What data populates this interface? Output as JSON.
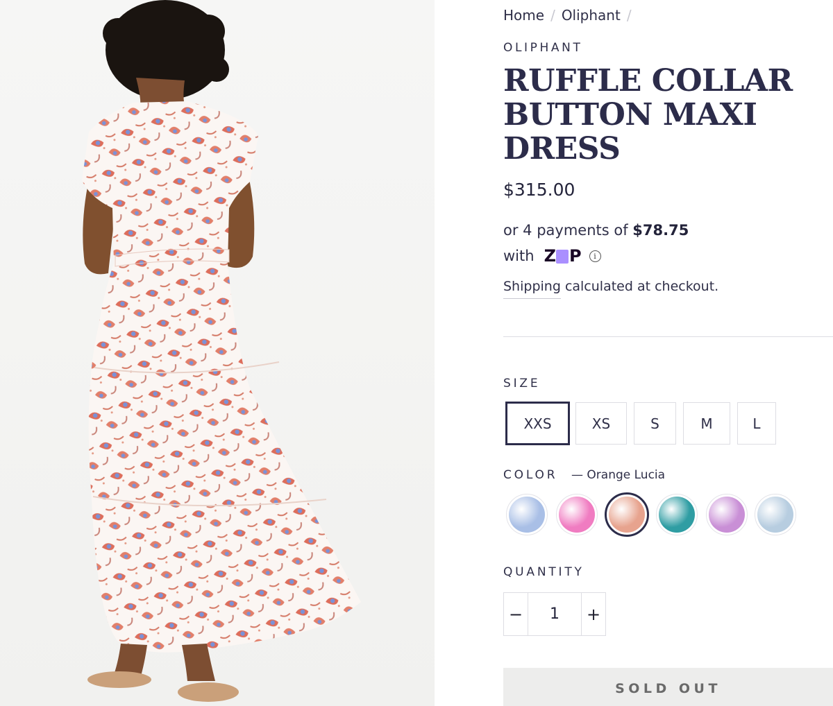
{
  "breadcrumb": {
    "items": [
      "Home",
      "Oliphant"
    ],
    "separator": "/"
  },
  "product": {
    "vendor": "OLIPHANT",
    "title": "RUFFLE COLLAR BUTTON MAXI DRESS",
    "price": "$315.00",
    "installments": {
      "prefix": "or 4 payments of",
      "amount": "$78.75",
      "with_label": "with",
      "provider": "zip",
      "info_glyph": "i"
    },
    "shipping": {
      "link_text": "Shipping",
      "rest_text": "calculated at checkout."
    }
  },
  "size": {
    "label": "SIZE",
    "options": [
      "XXS",
      "XS",
      "S",
      "M",
      "L"
    ],
    "selected": "XXS"
  },
  "color": {
    "label": "COLOR",
    "selected_display": "— Orange Lucia",
    "selected_index": 2,
    "swatches": [
      {
        "color": "#a9bfe6"
      },
      {
        "color": "#f07cc1"
      },
      {
        "color": "#e7a38e"
      },
      {
        "color": "#2f9da3"
      },
      {
        "color": "#c98fd6"
      },
      {
        "color": "#b7cde0"
      }
    ]
  },
  "quantity": {
    "label": "QUANTITY",
    "value": "1",
    "decrement_glyph": "−",
    "increment_glyph": "+"
  },
  "buy": {
    "sold_out_label": "SOLD OUT"
  },
  "colors": {
    "primary_text": "#2c2c4a",
    "zip_purple": "#aa8fff",
    "sold_out_bg": "#ededec"
  }
}
